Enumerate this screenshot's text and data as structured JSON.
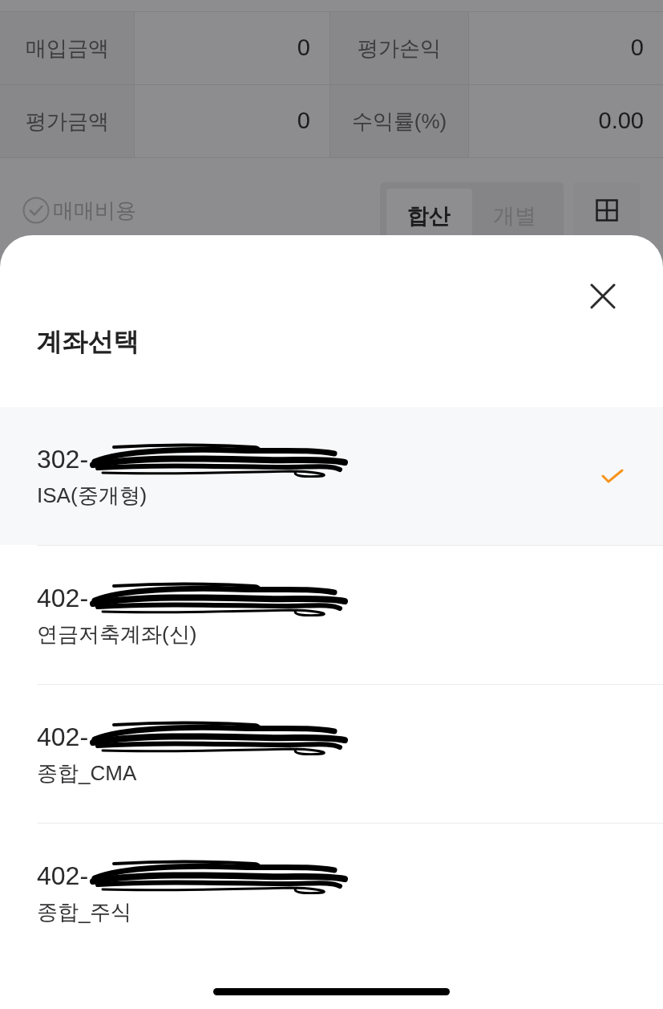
{
  "summary": {
    "rows": [
      [
        {
          "label": "매입금액",
          "value": "0"
        },
        {
          "label": "평가손익",
          "value": "0"
        }
      ],
      [
        {
          "label": "평가금액",
          "value": "0"
        },
        {
          "label": "수익률(%)",
          "value": "0.00"
        }
      ]
    ]
  },
  "options": {
    "trade_cost": {
      "label": "매매비용",
      "checked": false
    },
    "view_tabs": [
      {
        "label": "합산",
        "selected": true
      },
      {
        "label": "개별",
        "selected": false
      }
    ]
  },
  "sheet": {
    "title": "계좌선택",
    "accounts": [
      {
        "number": "302-",
        "name": "ISA(중개형)",
        "selected": true
      },
      {
        "number": "402-",
        "name": "연금저축계좌(신)",
        "selected": false
      },
      {
        "number": "402-",
        "name": "종합_CMA",
        "selected": false
      },
      {
        "number": "402-",
        "name": "종합_주식",
        "selected": false
      }
    ]
  }
}
